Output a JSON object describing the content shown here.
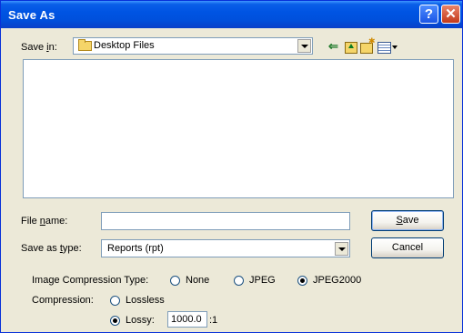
{
  "window": {
    "title": "Save As",
    "help_glyph": "?",
    "close_glyph": "✕"
  },
  "save_in": {
    "label_pre": "Save ",
    "label_accel": "i",
    "label_post": "n:",
    "folder": "Desktop Files",
    "back_glyph": "⇐"
  },
  "file_name": {
    "label_pre": "File ",
    "label_accel": "n",
    "label_post": "ame:",
    "value": ""
  },
  "save_as_type": {
    "label_pre": "Save as ",
    "label_accel": "t",
    "label_post": "ype:",
    "value": "Reports (rpt)"
  },
  "buttons": {
    "save_accel": "S",
    "save_rest": "ave",
    "cancel": "Cancel"
  },
  "compression": {
    "type_label": "Image Compression Type:",
    "types": [
      "None",
      "JPEG",
      "JPEG2000"
    ],
    "selected_type": "JPEG2000",
    "mode_label": "Compression:",
    "modes": [
      "Lossless",
      "Lossy:"
    ],
    "selected_mode": "Lossy:",
    "lossy_value": "1000.0",
    "ratio_suffix": ":1"
  }
}
